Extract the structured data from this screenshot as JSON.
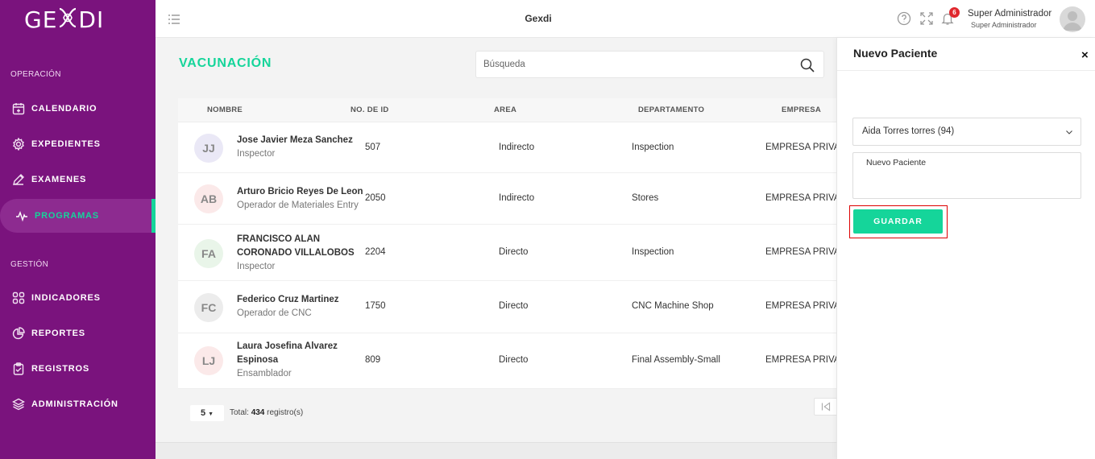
{
  "brand": {
    "logo_text_left": "GE",
    "logo_text_right": "DI"
  },
  "sidebar": {
    "sections": [
      {
        "title": "OPERACIÓN"
      },
      {
        "title": "GESTIÓN"
      }
    ],
    "items": [
      {
        "label": "CALENDARIO",
        "icon": "calendar-icon"
      },
      {
        "label": "EXPEDIENTES",
        "icon": "gear-icon"
      },
      {
        "label": "EXAMENES",
        "icon": "pencil-icon"
      },
      {
        "label": "PROGRAMAS",
        "icon": "pulse-icon",
        "active": true
      },
      {
        "label": "INDICADORES",
        "icon": "grid-icon"
      },
      {
        "label": "REPORTES",
        "icon": "pie-chart-icon"
      },
      {
        "label": "REGISTROS",
        "icon": "clipboard-icon"
      },
      {
        "label": "ADMINISTRACIÓN",
        "icon": "layers-icon"
      }
    ]
  },
  "header": {
    "title": "Gexdi",
    "notifications_count": "6",
    "user_name": "Super Administrador",
    "user_role": "Super Administrador"
  },
  "main": {
    "title": "VACUNACIÓN",
    "search_placeholder": "Búsqueda",
    "columns": [
      "NOMBRE",
      "NO. DE ID",
      "AREA",
      "DEPARTAMENTO",
      "EMPRESA"
    ],
    "rows": [
      {
        "initials": "JJ",
        "name": "Jose Javier Meza Sanchez",
        "role": "Inspector",
        "id": "507",
        "area": "Indirecto",
        "department": "Inspection",
        "company": "EMPRESA PRIVAI"
      },
      {
        "initials": "AB",
        "name": "Arturo Bricio Reyes De Leon",
        "role": "Operador de Materiales Entry",
        "id": "2050",
        "area": "Indirecto",
        "department": "Stores",
        "company": "EMPRESA PRIVAI"
      },
      {
        "initials": "FA",
        "name": "FRANCISCO ALAN CORONADO VILLALOBOS",
        "role": "Inspector",
        "id": "2204",
        "area": "Directo",
        "department": "Inspection",
        "company": "EMPRESA PRIVAI"
      },
      {
        "initials": "FC",
        "name": "Federico Cruz Martinez",
        "role": "Operador de CNC",
        "id": "1750",
        "area": "Directo",
        "department": "CNC Machine Shop",
        "company": "EMPRESA PRIVAI"
      },
      {
        "initials": "LJ",
        "name": "Laura Josefina Alvarez Espinosa",
        "role": "Ensamblador",
        "id": "809",
        "area": "Directo",
        "department": "Final Assembly-Small",
        "company": "EMPRESA PRIVAI"
      }
    ],
    "page_size": "5",
    "total_prefix": "Total:",
    "total_count": "434",
    "total_suffix": "registro(s)"
  },
  "panel": {
    "title": "Nuevo Paciente",
    "close": "×",
    "selected_patient": "Aida Torres torres (94)",
    "textarea_value": "Nuevo Paciente",
    "save_label": "GUARDAR"
  },
  "colors": {
    "sidebar": "#7a137d",
    "accent": "#15d59a",
    "badge": "#e0282e"
  }
}
